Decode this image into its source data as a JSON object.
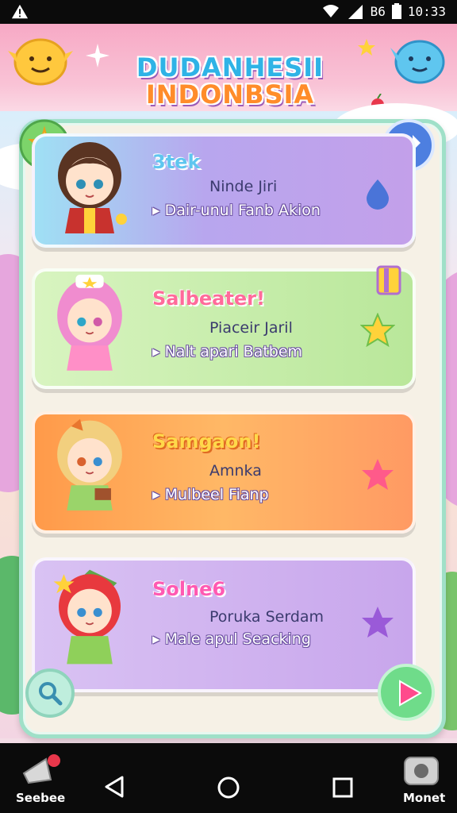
{
  "status_bar": {
    "signal_text": "B6",
    "time": "10:33"
  },
  "header": {
    "title_line1": "DUDANHESII",
    "title_line2": "INDONBSIA"
  },
  "cards": [
    {
      "title": "3tek",
      "subtitle": "Ninde Jiri",
      "detail": "▸ Dair-unul Fanb Akion",
      "icon": "drop-icon",
      "color": "#b89ce8"
    },
    {
      "title": "Salbeater!",
      "subtitle": "Piaceir Jaril",
      "detail": "▸ Nalt apari Batbem",
      "icon": "star-icon",
      "color": "#b8e89a"
    },
    {
      "title": "Samgaon!",
      "subtitle": "Amnka",
      "detail": "▸ Mulbeel Fianp",
      "icon": "star-icon",
      "color": "#ffab5a"
    },
    {
      "title": "Solne6",
      "subtitle": "Poruka Serdam",
      "detail": "▸ Male apul Seacking",
      "icon": "star-icon",
      "color": "#d6b4ec"
    }
  ],
  "bottom_nav": {
    "left_label": "Seebee",
    "right_label": "Monet"
  }
}
